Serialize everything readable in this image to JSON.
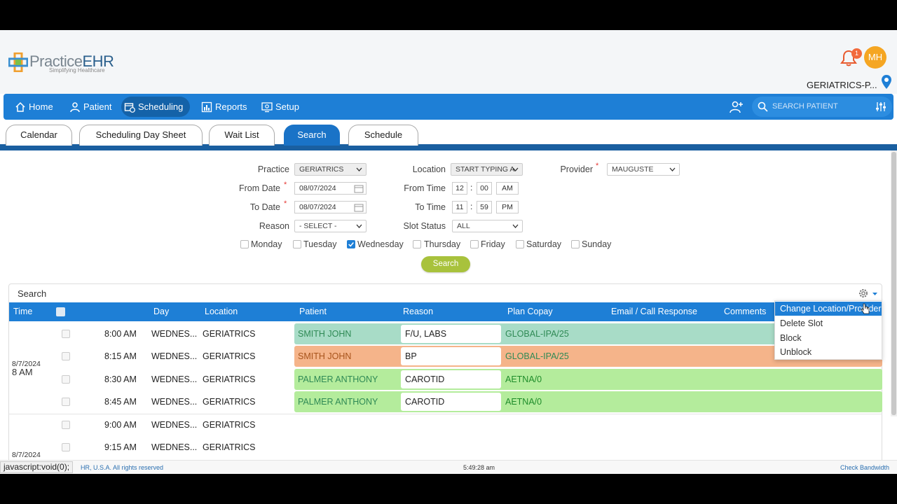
{
  "app": {
    "brand_main": "Practice",
    "brand_accent": "EHR",
    "tagline": "Simplifying Healthcare",
    "notification_count": "1",
    "user_initials": "MH",
    "practice_name": "GERIATRICS-P..."
  },
  "nav": {
    "items": [
      {
        "label": "Home",
        "icon": "home-icon"
      },
      {
        "label": "Patient",
        "icon": "user-icon"
      },
      {
        "label": "Scheduling",
        "icon": "calendar-clock-icon",
        "active": true
      },
      {
        "label": "Reports",
        "icon": "bar-chart-icon"
      },
      {
        "label": "Setup",
        "icon": "settings-screen-icon"
      }
    ],
    "search_placeholder": "SEARCH PATIENT"
  },
  "tabs": [
    {
      "label": "Calendar"
    },
    {
      "label": "Scheduling Day Sheet"
    },
    {
      "label": "Wait List"
    },
    {
      "label": "Search",
      "active": true
    },
    {
      "label": "Schedule"
    }
  ],
  "form": {
    "practice_label": "Practice",
    "practice_value": "GERIATRICS",
    "location_label": "Location",
    "location_placeholder": "START TYPING A",
    "provider_label": "Provider",
    "provider_value": "MAUGUSTE",
    "from_date_label": "From Date",
    "from_date_value": "08/07/2024",
    "to_date_label": "To Date",
    "to_date_value": "08/07/2024",
    "from_time_label": "From Time",
    "from_hour": "12",
    "from_min": "00",
    "from_ampm": "AM",
    "to_time_label": "To Time",
    "to_hour": "11",
    "to_min": "59",
    "to_ampm": "PM",
    "reason_label": "Reason",
    "reason_value": "- SELECT -",
    "slot_status_label": "Slot Status",
    "slot_status_value": "ALL",
    "required_mark": "*",
    "days": [
      {
        "label": "Monday",
        "checked": false
      },
      {
        "label": "Tuesday",
        "checked": false
      },
      {
        "label": "Wednesday",
        "checked": true
      },
      {
        "label": "Thursday",
        "checked": false
      },
      {
        "label": "Friday",
        "checked": false
      },
      {
        "label": "Saturday",
        "checked": false
      },
      {
        "label": "Sunday",
        "checked": false
      }
    ],
    "search_button": "Search"
  },
  "results": {
    "title": "Search",
    "columns": {
      "time": "Time",
      "day": "Day",
      "location": "Location",
      "patient": "Patient",
      "reason": "Reason",
      "plan_copay": "Plan Copay",
      "email_call": "Email / Call Response",
      "comments": "Comments"
    },
    "groups": [
      {
        "date": "8/7/2024",
        "hour": "8 AM"
      },
      {
        "date": "8/7/2024",
        "hour": ""
      }
    ],
    "rows": [
      {
        "time": "8:00 AM",
        "day": "WEDNES...",
        "location": "GERIATRICS",
        "patient": "SMITH JOHN",
        "reason": "F/U, LABS",
        "copay": "GLOBAL-IPA/25",
        "status_color": "#a8dcc7"
      },
      {
        "time": "8:15 AM",
        "day": "WEDNES...",
        "location": "GERIATRICS",
        "patient": "SMITH JOHN",
        "reason": "BP",
        "copay": "GLOBAL-IPA/25",
        "status_color": "#f5b48a"
      },
      {
        "time": "8:30 AM",
        "day": "WEDNES...",
        "location": "GERIATRICS",
        "patient": "PALMER ANTHONY",
        "reason": "CAROTID",
        "copay": "AETNA/0",
        "status_color": "#b4ec9c"
      },
      {
        "time": "8:45 AM",
        "day": "WEDNES...",
        "location": "GERIATRICS",
        "patient": "PALMER ANTHONY",
        "reason": "CAROTID",
        "copay": "AETNA/0",
        "status_color": "#b4ec9c"
      },
      {
        "time": "9:00 AM",
        "day": "WEDNES...",
        "location": "GERIATRICS",
        "patient": "",
        "reason": "",
        "copay": "",
        "status_color": ""
      },
      {
        "time": "9:15 AM",
        "day": "WEDNES...",
        "location": "GERIATRICS",
        "patient": "",
        "reason": "",
        "copay": "",
        "status_color": ""
      }
    ]
  },
  "context_menu": {
    "items": [
      "Change Location/Provider",
      "Delete Slot",
      "Block",
      "Unblock"
    ]
  },
  "footer": {
    "status_url": "javascript:void(0);",
    "copyright": "HR, U.S.A. All rights reserved",
    "clock": "5:49:28 am",
    "bandwidth": "Check Bandwidth"
  },
  "colors": {
    "primary": "#1e7fd6",
    "active_nav": "#1462a8",
    "search_button": "#a8c23c",
    "avatar": "#f5a623",
    "badge": "#f26a3c"
  }
}
